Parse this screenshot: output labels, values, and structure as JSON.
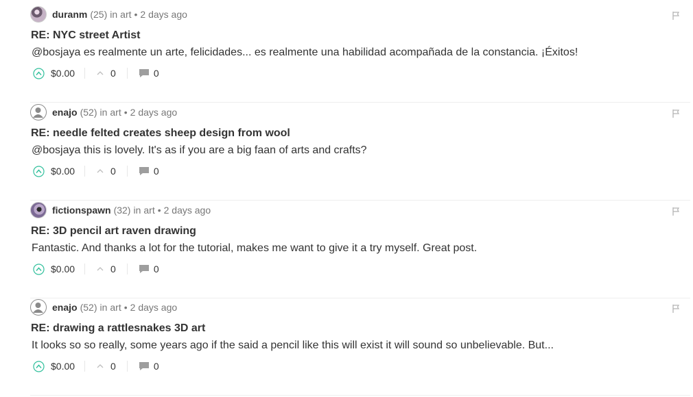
{
  "comments": [
    {
      "author": "duranm",
      "reputation": "(25)",
      "in_label": "in",
      "category": "art",
      "separator": "•",
      "timestamp": "2 days ago",
      "title": "RE: NYC street Artist",
      "body": "@bosjaya es realmente un arte, felicidades... es realmente una habilidad acompañada de la constancia. ¡Éxitos!",
      "payout": "$0.00",
      "votes": "0",
      "replies": "0",
      "avatar_icon": "user-photo"
    },
    {
      "author": "enajo",
      "reputation": "(52)",
      "in_label": "in",
      "category": "art",
      "separator": "•",
      "timestamp": "2 days ago",
      "title": "RE: needle felted creates sheep design from wool",
      "body": "@bosjaya this is lovely. It's as if you are a big faan of arts and crafts?",
      "payout": "$0.00",
      "votes": "0",
      "replies": "0",
      "avatar_icon": "default-user-icon"
    },
    {
      "author": "fictionspawn",
      "reputation": "(32)",
      "in_label": "in",
      "category": "art",
      "separator": "•",
      "timestamp": "2 days ago",
      "title": "RE: 3D pencil art raven drawing",
      "body": "Fantastic. And thanks a lot for the tutorial, makes me want to give it a try myself. Great post.",
      "payout": "$0.00",
      "votes": "0",
      "replies": "0",
      "avatar_icon": "user-photo"
    },
    {
      "author": "enajo",
      "reputation": "(52)",
      "in_label": "in",
      "category": "art",
      "separator": "•",
      "timestamp": "2 days ago",
      "title": "RE: drawing a rattlesnakes 3D art",
      "body": "It looks so so really, some years ago if the said a pencil like this will exist it will sound so unbelievable. But...",
      "payout": "$0.00",
      "votes": "0",
      "replies": "0",
      "avatar_icon": "default-user-icon"
    }
  ],
  "colors": {
    "vote_accent": "#2fbf9b",
    "text": "#333333",
    "muted": "#777777",
    "divider": "#eeeeee"
  }
}
